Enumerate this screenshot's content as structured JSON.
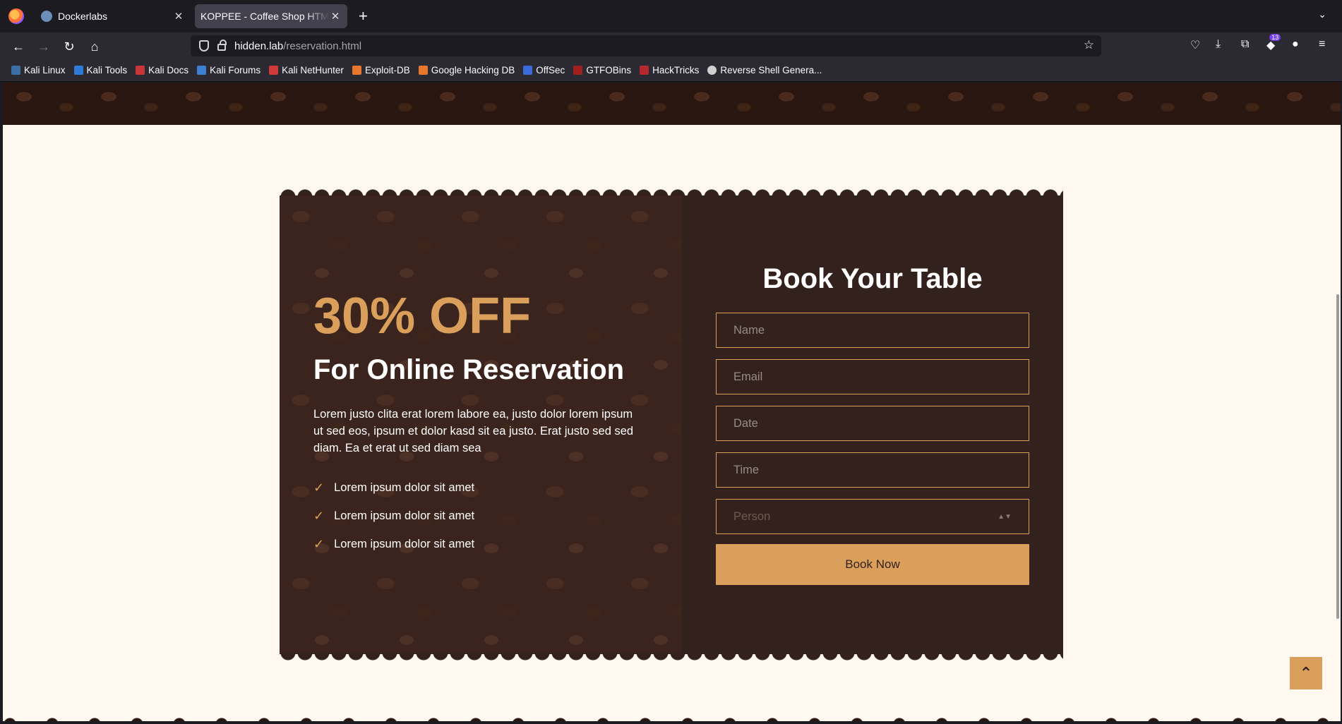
{
  "browser": {
    "tabs": [
      {
        "label": "Dockerlabs",
        "close": "✕"
      },
      {
        "label": "KOPPEE - Coffee Shop HTML Te",
        "close": "✕"
      }
    ],
    "new_tab": "+",
    "tabs_menu": "⌄",
    "nav": {
      "back": "←",
      "forward": "→",
      "reload": "↻",
      "home": "⌂"
    },
    "url": {
      "host": "hidden.lab",
      "path": "/reservation.html"
    },
    "star": "☆",
    "extension_badge": "13",
    "bookmarks": [
      {
        "label": "Kali Linux",
        "color": "#3b6ea5"
      },
      {
        "label": "Kali Tools",
        "color": "#2f7bd8"
      },
      {
        "label": "Kali Docs",
        "color": "#c8353b"
      },
      {
        "label": "Kali Forums",
        "color": "#3d7fd1"
      },
      {
        "label": "Kali NetHunter",
        "color": "#d13838"
      },
      {
        "label": "Exploit-DB",
        "color": "#e8772e"
      },
      {
        "label": "Google Hacking DB",
        "color": "#e8772e"
      },
      {
        "label": "OffSec",
        "color": "#3a6bd8"
      },
      {
        "label": "GTFOBins",
        "color": "#a01f1f"
      },
      {
        "label": "HackTricks",
        "color": "#b5282e"
      },
      {
        "label": "Reverse Shell Genera...",
        "color": "#cfcfcf"
      }
    ]
  },
  "reservation": {
    "discount": "30% OFF",
    "subtitle": "For Online Reservation",
    "description": "Lorem justo clita erat lorem labore ea, justo dolor lorem ipsum ut sed eos, ipsum et dolor kasd sit ea justo. Erat justo sed sed diam. Ea et erat ut sed diam sea",
    "check": "✓",
    "features": [
      "Lorem ipsum dolor sit amet",
      "Lorem ipsum dolor sit amet",
      "Lorem ipsum dolor sit amet"
    ],
    "form": {
      "title": "Book Your Table",
      "name_placeholder": "Name",
      "email_placeholder": "Email",
      "date_placeholder": "Date",
      "time_placeholder": "Time",
      "person_selected": "Person",
      "submit": "Book Now"
    }
  },
  "back_to_top": "⌃",
  "colors": {
    "accent": "#da9f5b",
    "panel": "#33211d",
    "page_bg": "#fff8f0"
  }
}
